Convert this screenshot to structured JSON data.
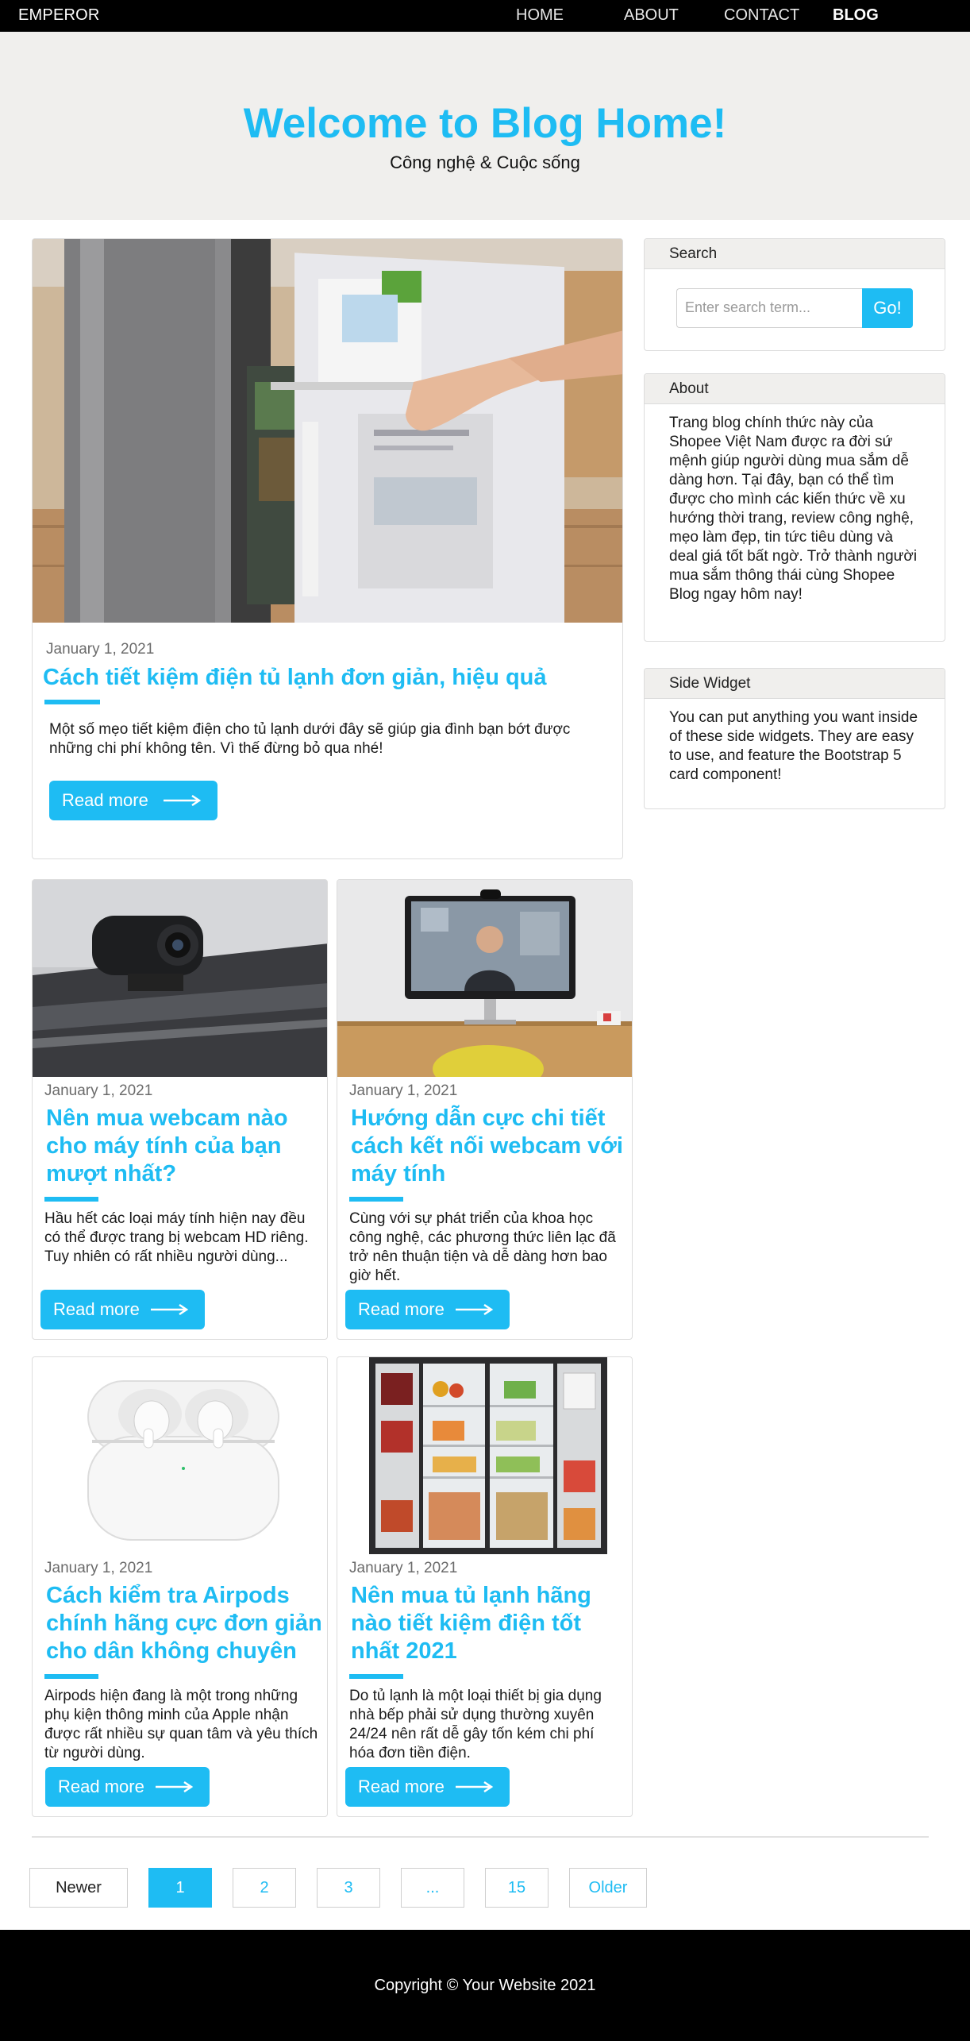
{
  "nav": {
    "brand": "EMPEROR",
    "links": [
      "HOME",
      "ABOUT",
      "CONTACT",
      "BLOG"
    ]
  },
  "hero": {
    "title": "Welcome to Blog Home!",
    "subtitle": "Công nghệ & Cuộc sống"
  },
  "featured": {
    "date": "January 1, 2021",
    "title": "Cách tiết kiệm điện tủ lạnh đơn giản, hiệu quả",
    "excerpt": "Một số mẹo tiết kiệm điện cho tủ lạnh dưới đây sẽ giúp gia đình bạn bớt được những chi phí không tên. Vì thế đừng bỏ qua nhé!",
    "button": "Read more"
  },
  "posts": [
    {
      "date": "January 1, 2021",
      "title": "Nên mua webcam nào cho máy tính của bạn mượt nhất?",
      "excerpt": "Hầu hết các loại máy tính hiện nay đều có thể được trang bị webcam HD riêng. Tuy nhiên có rất nhiều người dùng...",
      "button": "Read more"
    },
    {
      "date": "January 1, 2021",
      "title": "Hướng dẫn cực chi tiết cách kết nối webcam với máy tính",
      "excerpt": "Cùng với sự phát triển của khoa học công nghệ, các phương thức liên lạc đã trở nên thuận tiện và dễ dàng hơn bao giờ hết.",
      "button": "Read more"
    },
    {
      "date": "January 1, 2021",
      "title": "Cách kiểm tra Airpods chính hãng cực đơn giản cho dân không chuyên",
      "excerpt": "Airpods hiện đang là một trong những phụ kiện thông minh của Apple nhận được rất nhiều sự quan tâm và yêu thích từ người dùng.",
      "button": "Read more"
    },
    {
      "date": "January 1, 2021",
      "title": "Nên mua tủ lạnh hãng nào tiết kiệm điện tốt nhất 2021",
      "excerpt": "Do tủ lạnh là một loại thiết bị gia dụng nhà bếp phải sử dụng thường xuyên 24/24 nên rất dễ gây tốn kém chi phí hóa đơn tiền điện.",
      "button": "Read more"
    }
  ],
  "sidebar": {
    "search": {
      "title": "Search",
      "placeholder": "Enter search term...",
      "button": "Go!"
    },
    "about": {
      "title": "About",
      "text": "Trang blog chính thức này của Shopee Việt Nam được ra đời sứ mệnh giúp người dùng mua sắm dễ dàng hơn. Tại đây, bạn có thể tìm được cho mình các kiến thức về xu hướng thời trang, review công nghệ, mẹo làm đẹp, tin tức tiêu dùng và deal giá tốt bất ngờ. Trở thành người mua sắm thông thái cùng Shopee Blog ngay hôm nay!"
    },
    "widget": {
      "title": "Side Widget",
      "text": "You can put anything you want inside of these side widgets. They are easy to use, and feature the Bootstrap 5 card component!"
    }
  },
  "pagination": {
    "newer": "Newer",
    "pages": [
      "1",
      "2",
      "3",
      "...",
      "15"
    ],
    "older": "Older"
  },
  "footer": {
    "text": "Copyright © Your Website 2021"
  },
  "colors": {
    "accent": "#1ebcf3",
    "hero_bg": "#f0efed",
    "nav_bg": "#000000"
  }
}
